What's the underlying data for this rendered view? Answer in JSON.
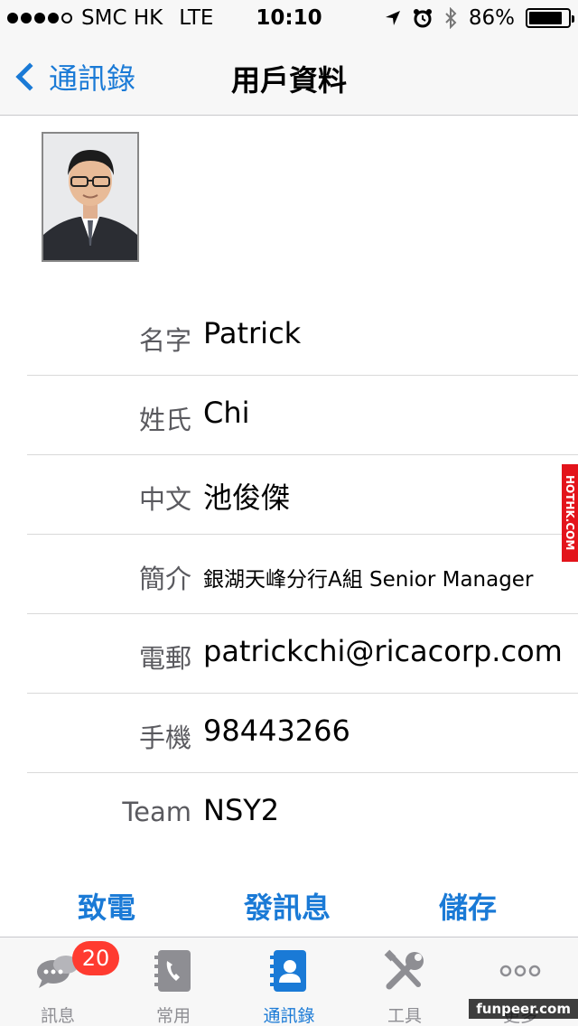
{
  "status_bar": {
    "carrier": "SMC HK",
    "network": "LTE",
    "time": "10:10",
    "battery": "86%",
    "battery_level": 0.86
  },
  "nav": {
    "back_label": "通訊錄",
    "title": "用戶資料"
  },
  "fields": [
    {
      "label": "名字",
      "value": "Patrick"
    },
    {
      "label": "姓氏",
      "value": "Chi"
    },
    {
      "label": "中文",
      "value": "池俊傑"
    },
    {
      "label": "簡介",
      "value": "銀湖天峰分行A組 Senior Manager"
    },
    {
      "label": "電郵",
      "value": "patrickchi@ricacorp.com"
    },
    {
      "label": "手機",
      "value": "98443266"
    },
    {
      "label": "Team",
      "value": "NSY2"
    }
  ],
  "actions": {
    "call": "致電",
    "message": "發訊息",
    "save": "儲存"
  },
  "tabs": [
    {
      "label": "訊息",
      "icon": "chat-bubbles-icon",
      "badge": "20"
    },
    {
      "label": "常用",
      "icon": "phone-book-icon"
    },
    {
      "label": "通訊錄",
      "icon": "contacts-icon",
      "active": true
    },
    {
      "label": "工具",
      "icon": "tools-icon"
    },
    {
      "label": "更多",
      "icon": "more-dots-icon"
    }
  ],
  "watermarks": {
    "side": "HOTHK.COM",
    "corner": "funpeer.com"
  },
  "colors": {
    "accent": "#1a7ad6",
    "badge": "#ff3b30",
    "inactive": "#8e8e93"
  }
}
